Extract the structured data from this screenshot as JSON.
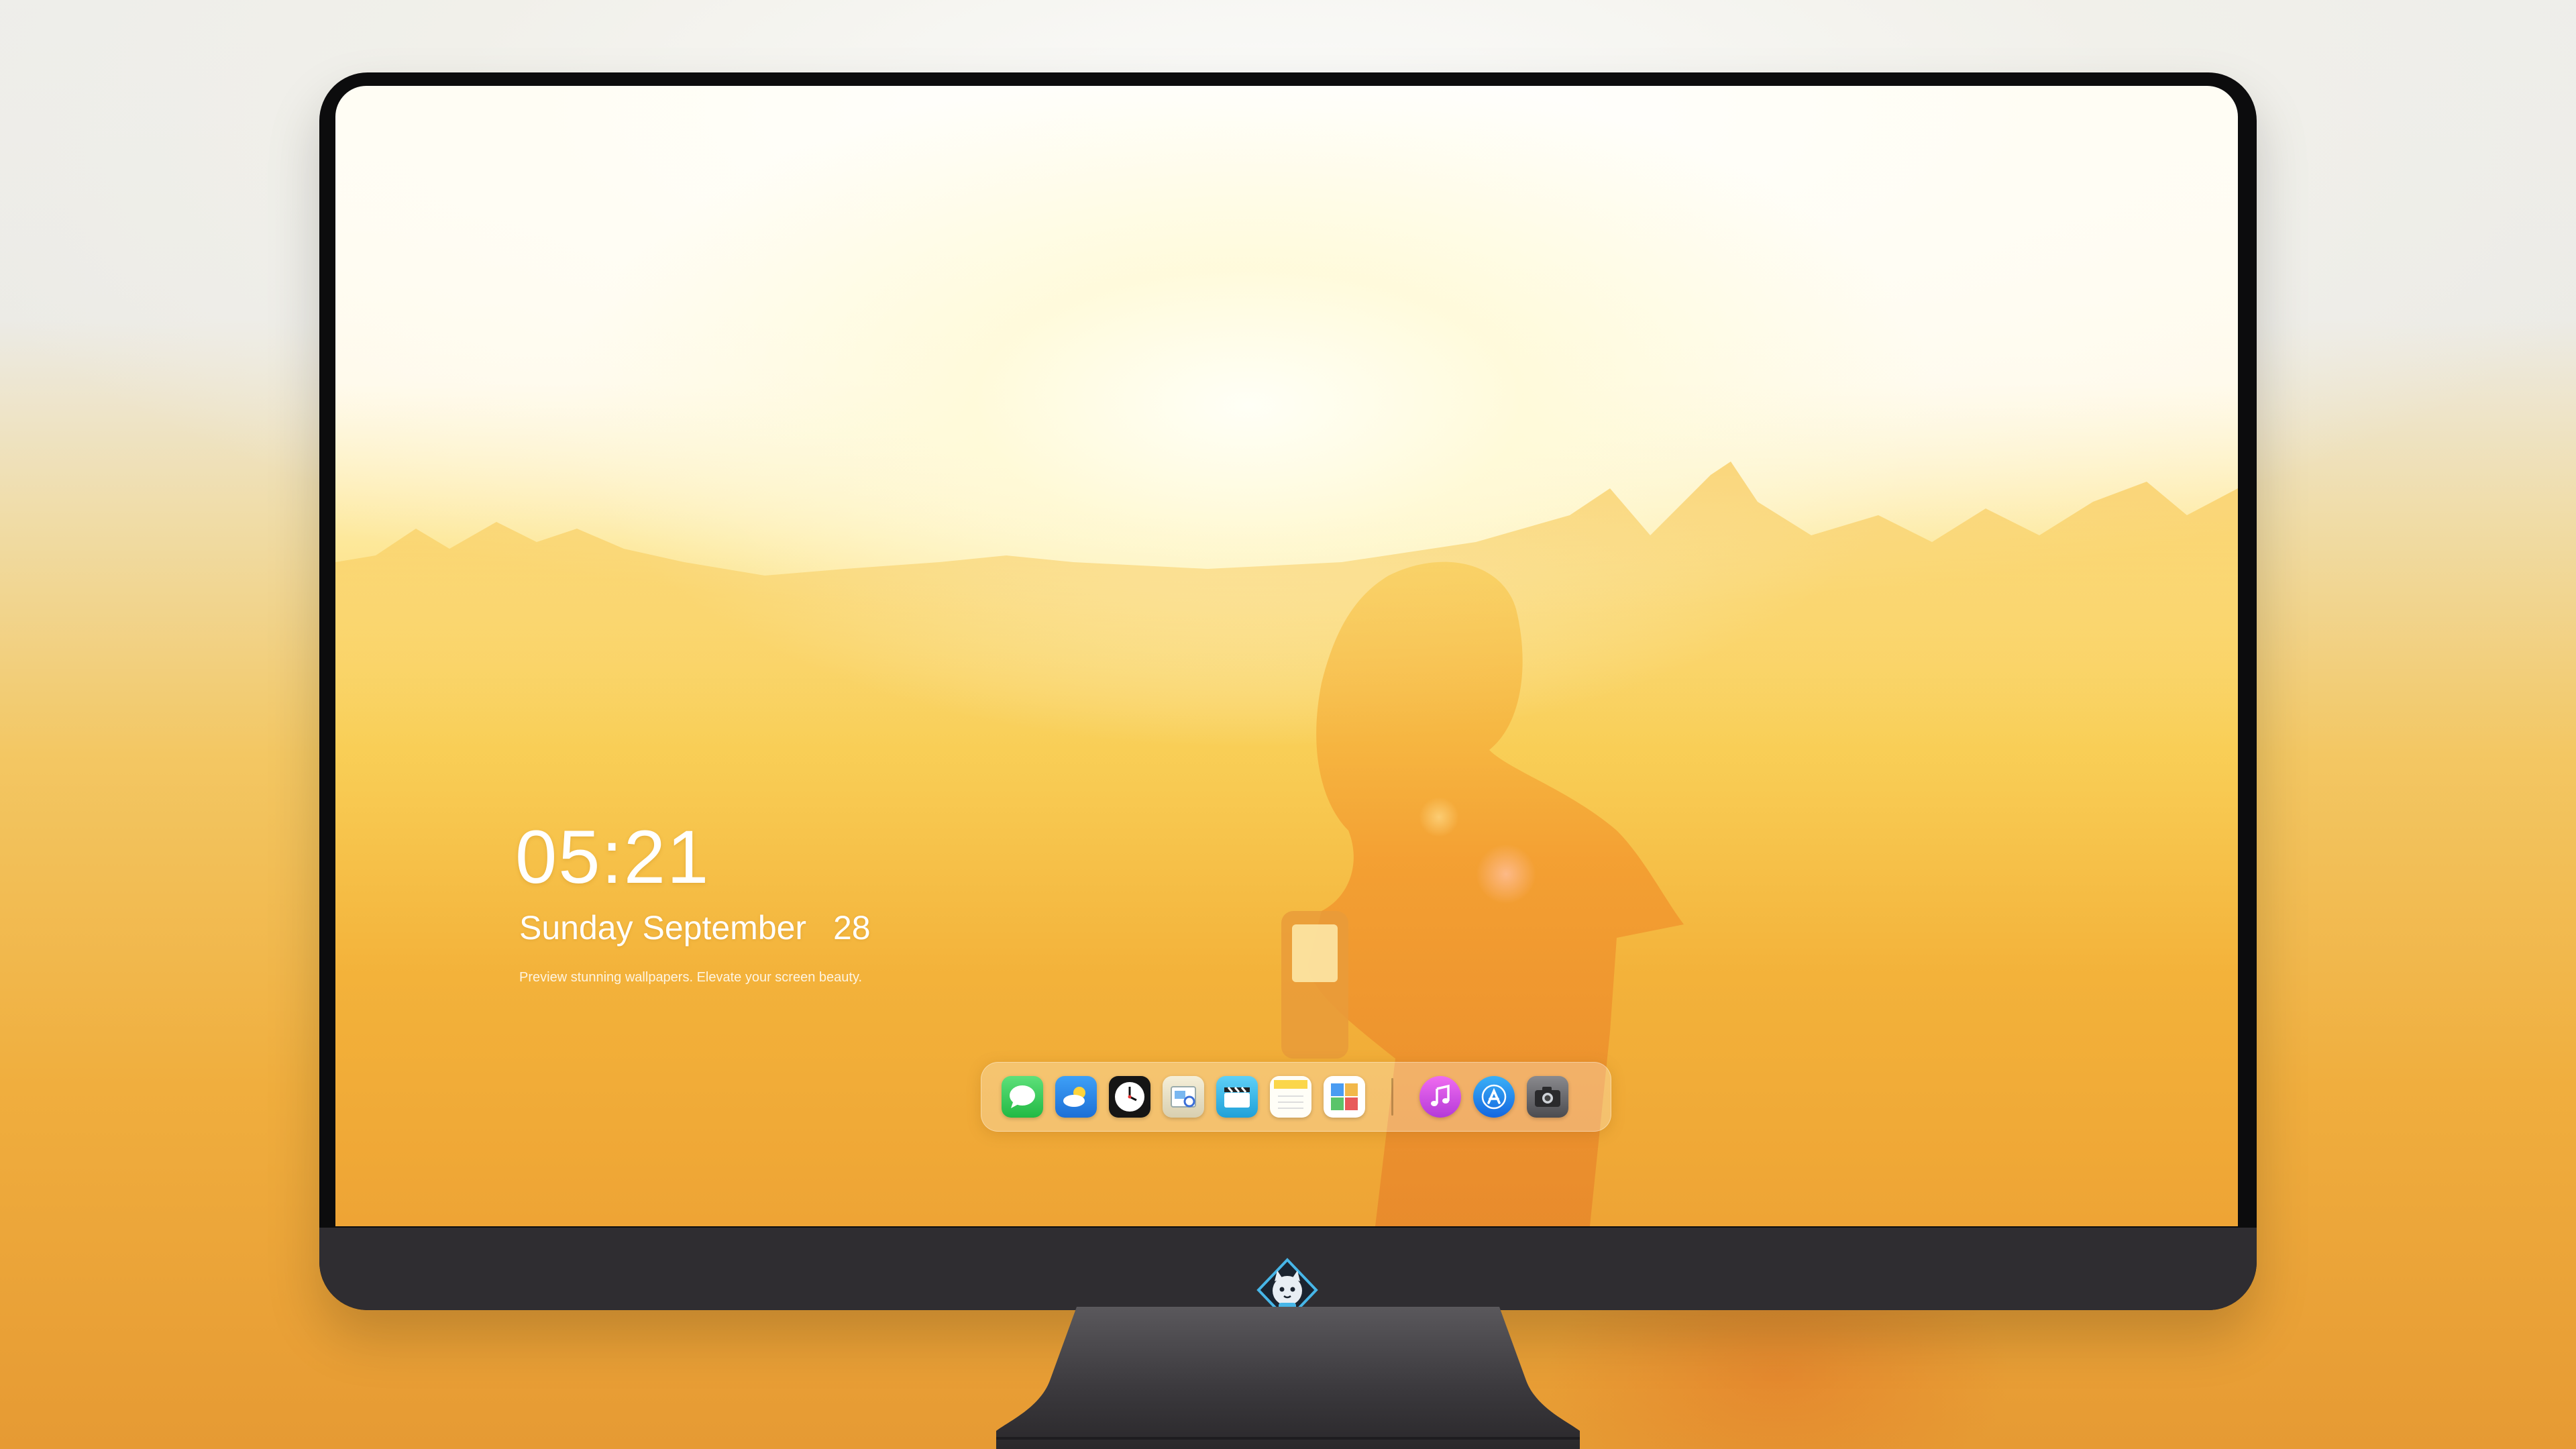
{
  "desktop": {
    "time": "05:21",
    "weekday": "Sunday",
    "month": "September",
    "day": "28",
    "tagline": "Preview stunning wallpapers. Elevate your screen beauty."
  },
  "dock": {
    "apps": [
      {
        "name": "Messages",
        "icon": "messages-icon",
        "color": "#2bc94a"
      },
      {
        "name": "Weather",
        "icon": "weather-icon",
        "color": "#2f8ff0"
      },
      {
        "name": "Clock",
        "icon": "clock-icon",
        "color": "#111111"
      },
      {
        "name": "Preview",
        "icon": "preview-icon",
        "color": "#e8e2cf"
      },
      {
        "name": "Clips",
        "icon": "clips-icon",
        "color": "#3fb7e8"
      },
      {
        "name": "Notes",
        "icon": "notes-icon",
        "color": "#fbe27a"
      },
      {
        "name": "Photo Booth",
        "icon": "photo-booth-icon",
        "color": "#ffffff"
      },
      {
        "name": "Music",
        "icon": "music-icon",
        "color": "#d84cd8"
      },
      {
        "name": "App Store",
        "icon": "app-store-icon",
        "color": "#1d8ff2"
      },
      {
        "name": "Camera",
        "icon": "camera-icon",
        "color": "#6d6d70"
      }
    ]
  },
  "colors": {
    "bezel": "#0c0c0d",
    "chin": "#2f2d31",
    "sky_glow": "#fffdf4",
    "sun_orange": "#f3b23a"
  }
}
